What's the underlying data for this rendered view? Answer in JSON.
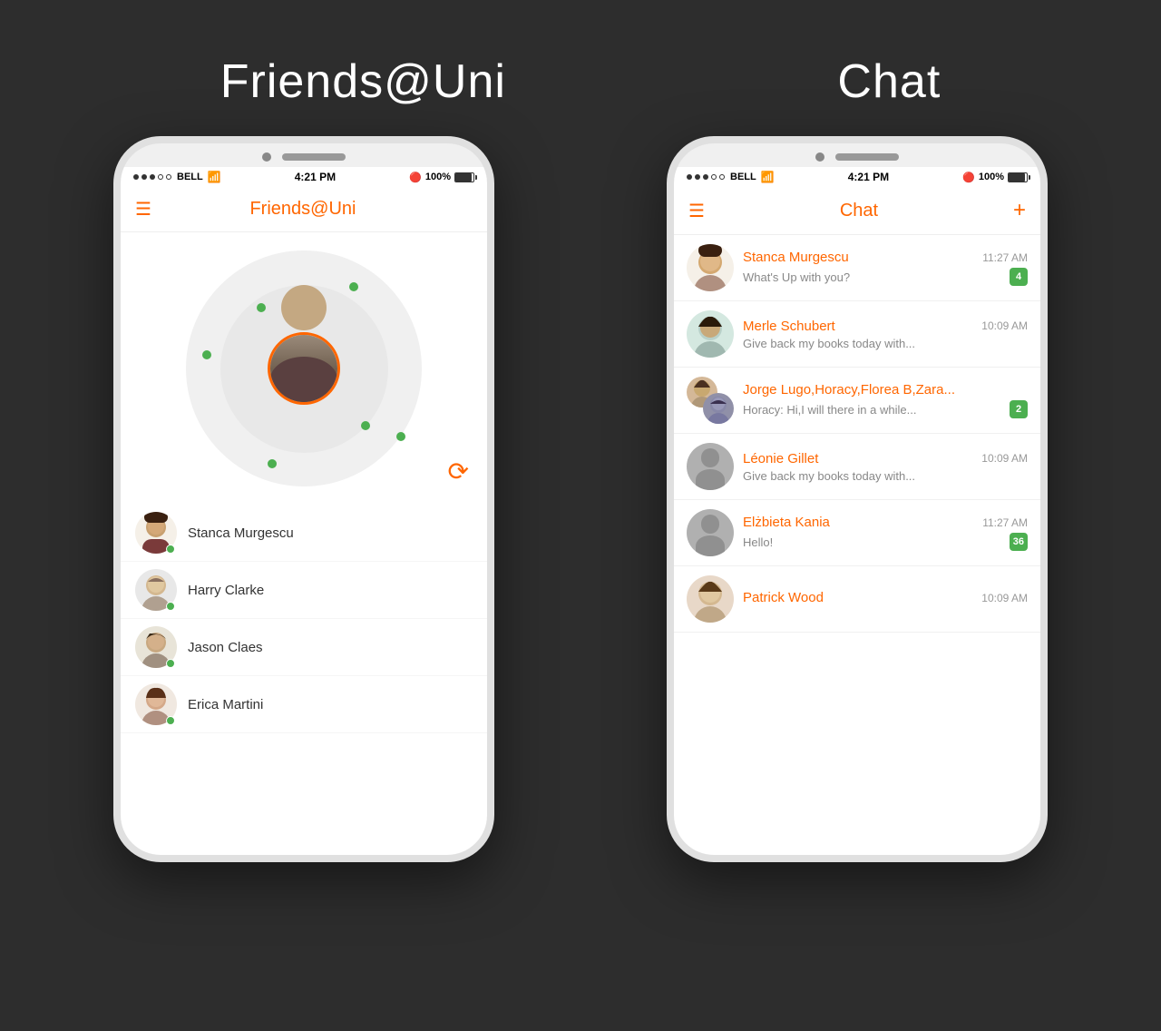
{
  "background_color": "#2d2d2d",
  "section1": {
    "title": "Friends@Uni"
  },
  "section2": {
    "title": "Chat"
  },
  "phone1": {
    "status_bar": {
      "carrier": "BELL",
      "time": "4:21 PM",
      "battery": "100%"
    },
    "navbar": {
      "title": "Friends@Uni"
    },
    "friends": [
      {
        "name": "Stanca Murgescu",
        "online": true,
        "avatar_color": "#e8d8c0"
      },
      {
        "name": "Harry Clarke",
        "online": true,
        "avatar_color": "#d0d0d0"
      },
      {
        "name": "Jason Claes",
        "online": true,
        "avatar_color": "#c8c0a8"
      },
      {
        "name": "Erica Martini",
        "online": true,
        "avatar_color": "#e0ccc0"
      }
    ],
    "refresh_button": "↺"
  },
  "phone2": {
    "status_bar": {
      "carrier": "BELL",
      "time": "4:21 PM",
      "battery": "100%"
    },
    "navbar": {
      "title": "Chat",
      "add_button": "+"
    },
    "chats": [
      {
        "name": "Stanca Murgescu",
        "time": "11:27 AM",
        "preview": "What's Up with you?",
        "badge": "4",
        "avatar_color": "#e8d8c0",
        "group": false
      },
      {
        "name": "Merle Schubert",
        "time": "10:09 AM",
        "preview": "Give back my books today with...",
        "badge": "",
        "avatar_color": "#c8e0d4",
        "group": false
      },
      {
        "name": "Jorge Lugo,Horacy,Florea B,Zara...",
        "time": "",
        "preview": "Horacy: Hi,I will there in a while...",
        "badge": "2",
        "avatar_color": "#c8b8a8",
        "avatar_color2": "#9090a0",
        "group": true
      },
      {
        "name": "Léonie Gillet",
        "time": "10:09 AM",
        "preview": "Give back my books today with...",
        "badge": "",
        "avatar_color": "#c0c0c0",
        "group": false,
        "placeholder": true
      },
      {
        "name": "Elżbieta Kania",
        "time": "11:27 AM",
        "preview": "Hello!",
        "badge": "36",
        "avatar_color": "#b8b8b8",
        "group": false,
        "placeholder": true
      },
      {
        "name": "Patrick Wood",
        "time": "10:09 AM",
        "preview": "",
        "badge": "",
        "avatar_color": "#d4c4b0",
        "group": false
      }
    ]
  }
}
